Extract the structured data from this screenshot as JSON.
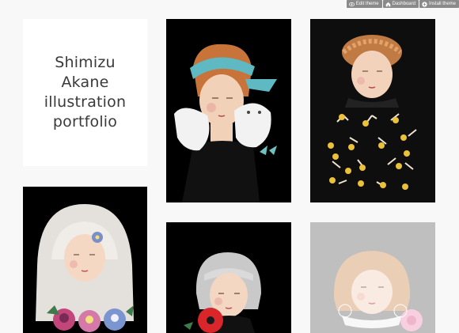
{
  "controls": {
    "edit_theme": "Edit theme",
    "dashboard": "Dashboard",
    "install_theme": "Install theme"
  },
  "title_lines": [
    "Shimizu",
    "Akane",
    "illustration",
    "portfolio"
  ],
  "icons": {
    "edit": "eye-icon",
    "dashboard": "home-icon",
    "install": "plus-circle-icon"
  },
  "colors": {
    "background": "#f8f8f8",
    "title_card": "#ffffff",
    "title_text": "#3a3a3a",
    "control_bg": "#8a8a8a"
  }
}
